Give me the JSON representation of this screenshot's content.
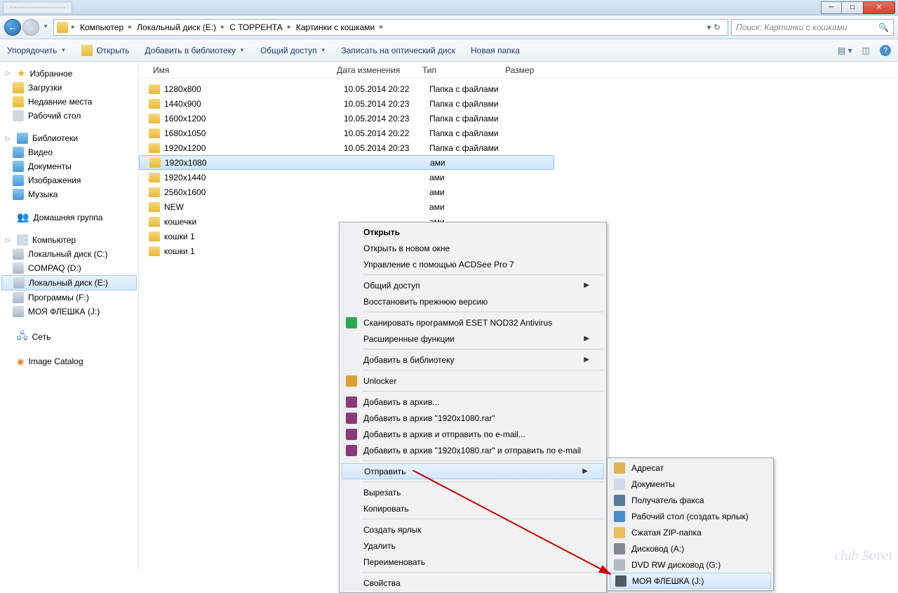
{
  "titlebar": {
    "tab": "······················"
  },
  "win": {
    "min": "─",
    "max": "□",
    "close": "✕"
  },
  "nav": {
    "back": "←",
    "fwd": "→",
    "path": [
      "Компьютер",
      "Локальный диск (E:)",
      "С ТОРРЕНТА",
      "Картинки с кошками"
    ],
    "refresh": "↻"
  },
  "search": {
    "placeholder": "Поиск: Картинки с кошками",
    "icon": "🔍"
  },
  "toolbar": {
    "organize": "Упорядочить",
    "open": "Открыть",
    "addlib": "Добавить в библиотеку",
    "share": "Общий доступ",
    "burn": "Записать на оптический диск",
    "newfolder": "Новая папка",
    "help": "?"
  },
  "sidebar": {
    "fav": "Избранное",
    "fav_items": [
      "Загрузки",
      "Недавние места",
      "Рабочий стол"
    ],
    "lib": "Библиотеки",
    "lib_items": [
      "Видео",
      "Документы",
      "Изображения",
      "Музыка"
    ],
    "home": "Домашняя группа",
    "comp": "Компьютер",
    "drives": [
      "Локальный диск (C:)",
      "COMPAQ (D:)",
      "Локальный диск (E:)",
      "Программы  (F:)",
      "МОЯ ФЛЕШКА (J:)"
    ],
    "net": "Сеть",
    "imgcat": "Image Catalog"
  },
  "cols": {
    "name": "Имя",
    "date": "Дата изменения",
    "type": "Тип",
    "size": "Размер"
  },
  "type_folder": "Папка с файлами",
  "rows": [
    {
      "name": "1280x800",
      "date": "10.05.2014 20:22"
    },
    {
      "name": "1440x900",
      "date": "10.05.2014 20:23"
    },
    {
      "name": "1600x1200",
      "date": "10.05.2014 20:23"
    },
    {
      "name": "1680x1050",
      "date": "10.05.2014 20:22"
    },
    {
      "name": "1920x1200",
      "date": "10.05.2014 20:23"
    },
    {
      "name": "1920x1080",
      "date": "",
      "selected": true
    },
    {
      "name": "1920x1440",
      "date": ""
    },
    {
      "name": "2560x1600",
      "date": ""
    },
    {
      "name": "NEW",
      "date": ""
    },
    {
      "name": "кошечки",
      "date": ""
    },
    {
      "name": "кошки 1",
      "date": ""
    },
    {
      "name": "кошки 1",
      "date": ""
    }
  ],
  "ctx1": [
    {
      "t": "Открыть",
      "bold": true
    },
    {
      "t": "Открыть в новом окне"
    },
    {
      "t": "Управление с помощью ACDSee Pro 7"
    },
    {
      "sep": true
    },
    {
      "t": "Общий доступ",
      "sub": true
    },
    {
      "t": "Восстановить прежнюю версию"
    },
    {
      "sep": true
    },
    {
      "t": "Сканировать программой ESET NOD32 Antivirus",
      "ico": "eset"
    },
    {
      "t": "Расширенные функции",
      "sub": true
    },
    {
      "sep": true
    },
    {
      "t": "Добавить в библиотеку",
      "sub": true
    },
    {
      "sep": true
    },
    {
      "t": "Unlocker",
      "ico": "key"
    },
    {
      "sep": true
    },
    {
      "t": "Добавить в архив...",
      "ico": "rar"
    },
    {
      "t": "Добавить в архив \"1920x1080.rar\"",
      "ico": "rar"
    },
    {
      "t": "Добавить в архив и отправить по e-mail...",
      "ico": "rar"
    },
    {
      "t": "Добавить в архив \"1920x1080.rar\" и отправить по e-mail",
      "ico": "rar"
    },
    {
      "sep": true
    },
    {
      "t": "Отправить",
      "sub": true,
      "hov": true
    },
    {
      "sep": true
    },
    {
      "t": "Вырезать"
    },
    {
      "t": "Копировать"
    },
    {
      "sep": true
    },
    {
      "t": "Создать ярлык"
    },
    {
      "t": "Удалить"
    },
    {
      "t": "Переименовать"
    },
    {
      "sep": true
    },
    {
      "t": "Свойства"
    }
  ],
  "ctx2": [
    {
      "t": "Адресат",
      "ico": "mail"
    },
    {
      "t": "Документы",
      "ico": "doc"
    },
    {
      "t": "Получатель факса",
      "ico": "fax"
    },
    {
      "t": "Рабочий стол (создать ярлык)",
      "ico": "desk"
    },
    {
      "t": "Сжатая ZIP-папка",
      "ico": "zip"
    },
    {
      "t": "Дисковод (A:)",
      "ico": "floppy"
    },
    {
      "t": "DVD RW дисковод (G:)",
      "ico": "dvd"
    },
    {
      "t": "МОЯ ФЛЕШКА (J:)",
      "ico": "usb",
      "hov": true
    }
  ],
  "watermark": "club Sovet"
}
